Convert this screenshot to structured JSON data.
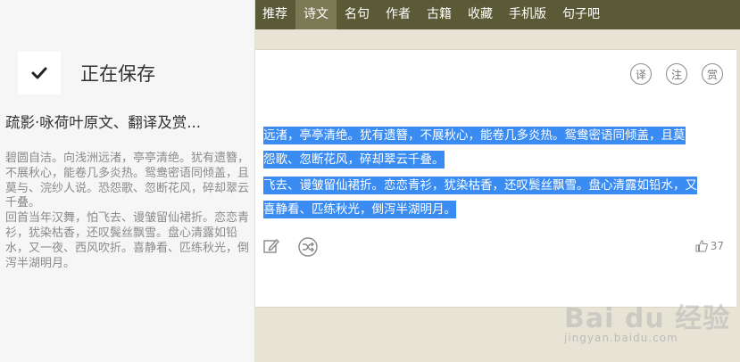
{
  "nav": {
    "items": [
      {
        "label": "推荐"
      },
      {
        "label": "诗文"
      },
      {
        "label": "名句"
      },
      {
        "label": "作者"
      },
      {
        "label": "古籍"
      },
      {
        "label": "收藏"
      },
      {
        "label": "手机版"
      },
      {
        "label": "句子吧"
      }
    ],
    "active": "诗文"
  },
  "poem": {
    "buttons": {
      "translate": "译",
      "annotate": "注",
      "appreciate": "赏"
    },
    "lines": [
      "远渚，亭亭清绝。犹有遗簪，不展秋心，能卷几多炎热。鸳鸯密语同倾盖，且莫",
      "怨歌、忽断花风，碎却翠云千叠。",
      "飞去、谩皱留仙裙折。恋恋青衫，犹染枯香，还叹鬓丝飘雪。盘心清露如铅水，又",
      "喜静看、匹练秋光，倒泻半湖明月。"
    ],
    "like_count": "37"
  },
  "save_panel": {
    "status": "正在保存",
    "title": "疏影·咏荷叶原文、翻译及赏...",
    "paragraphs": [
      "碧圆自洁。向浅洲远渚，亭亭清绝。犹有遗簪，不展秋心，能卷几多炎热。鸳鸯密语同倾盖，且莫与、浣纱人说。恐怨歌、忽断花风，碎却翠云千叠。",
      "回首当年汉舞，怕飞去、谩皱留仙裙折。恋恋青衫，犹染枯香，还叹鬓丝飘雪。盘心清露如铅水，又一夜、西风吹折。喜静看、匹练秋光，倒泻半湖明月。"
    ]
  },
  "watermark": {
    "main": "Bai du 经验",
    "sub": "jingyan.baidu.com"
  },
  "colors": {
    "nav_bg": "#5b5a36",
    "nav_active": "#7b7a55",
    "selection": "#3a8bf2",
    "page_bg": "#e7e4d6"
  }
}
